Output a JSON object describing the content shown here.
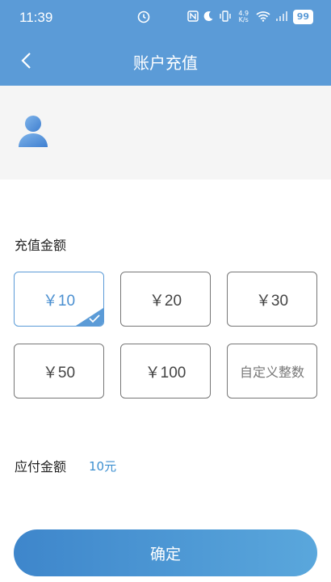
{
  "status": {
    "time": "11:39",
    "center_icon": "clock-badge-icon",
    "net_speed": "4.9 K/s",
    "battery": "99"
  },
  "header": {
    "title": "账户充值",
    "back_icon": "chevron-left-icon"
  },
  "profile": {
    "avatar_icon": "user-avatar-icon"
  },
  "recharge": {
    "label": "充值金额",
    "options": [
      "￥10",
      "￥20",
      "￥30",
      "￥50",
      "￥100",
      "自定义整数"
    ],
    "selected_index": 0
  },
  "payment": {
    "label": "应付金额",
    "value": "10元"
  },
  "confirm_label": "确定",
  "colors": {
    "accent": "#5b9bd7",
    "selected_text": "#4a8fd0",
    "amount_text": "#3c8fd0"
  }
}
